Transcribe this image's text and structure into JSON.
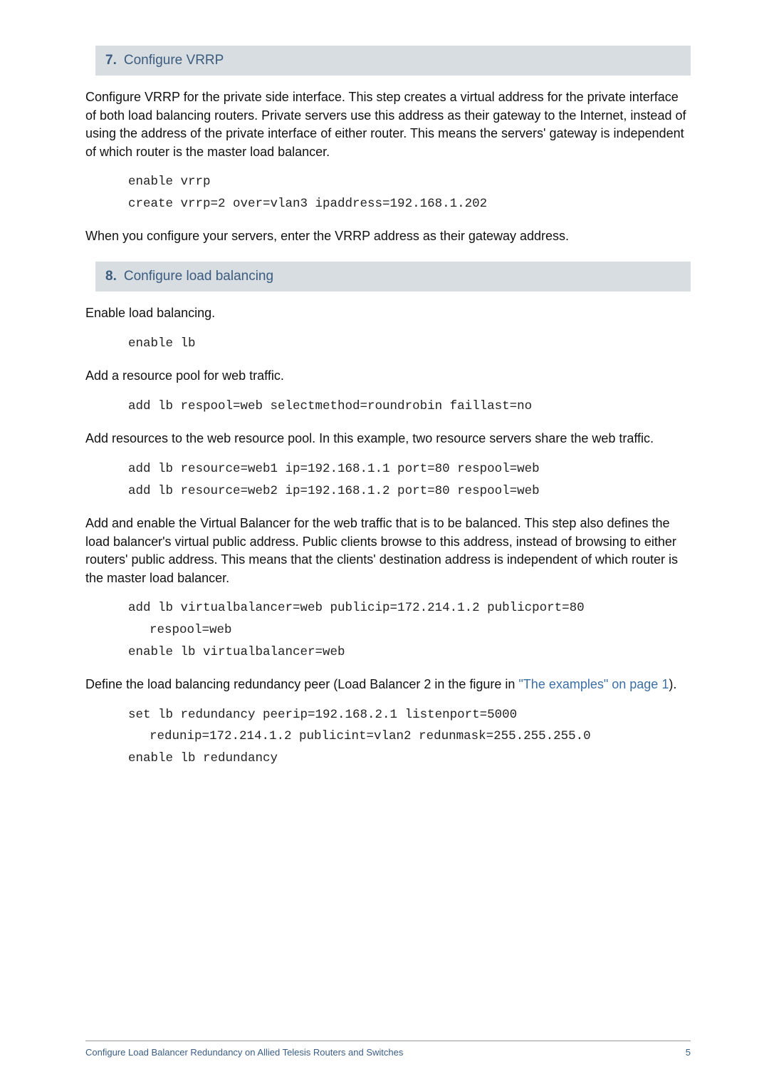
{
  "step7": {
    "number": "7.",
    "title": "Configure VRRP",
    "para1": "Configure VRRP for the private side interface. This step creates a virtual address for the private interface of both load balancing routers. Private servers use this address as their gateway to the Internet, instead of using the address of the private interface of either router. This means the servers' gateway is independent of which router is the master load balancer.",
    "code1_line1": "enable vrrp",
    "code1_line2": "create vrrp=2 over=vlan3 ipaddress=192.168.1.202",
    "para2": "When you configure your servers, enter the VRRP address as their gateway address."
  },
  "step8": {
    "number": "8.",
    "title": "Configure load balancing",
    "para1": "Enable load balancing.",
    "code1": "enable lb",
    "para2": "Add a resource pool for web traffic.",
    "code2": "add lb respool=web selectmethod=roundrobin faillast=no",
    "para3": "Add resources to the web resource pool. In this example, two resource servers share the web traffic.",
    "code3_line1": "add lb resource=web1 ip=192.168.1.1 port=80 respool=web",
    "code3_line2": "add lb resource=web2 ip=192.168.1.2 port=80 respool=web",
    "para4": "Add and enable the Virtual Balancer for the web traffic that is to be balanced. This step also defines the load balancer's virtual public address. Public clients browse to this address, instead of browsing to either routers' public address. This means that the clients' destination address is independent of which router is the master load balancer.",
    "code4_line1": "add lb virtualbalancer=web publicip=172.214.1.2 publicport=80",
    "code4_line1b": "respool=web",
    "code4_line2": "enable lb virtualbalancer=web",
    "para5a": "Define the load balancing redundancy peer (Load Balancer 2 in the figure in ",
    "para5_link": "\"The examples\" on page 1",
    "para5b": ").",
    "code5_line1": "set lb redundancy peerip=192.168.2.1 listenport=5000",
    "code5_line1b": "redunip=172.214.1.2 publicint=vlan2 redunmask=255.255.255.0",
    "code5_line2": "enable lb redundancy"
  },
  "footer": {
    "title": "Configure Load Balancer Redundancy on Allied Telesis Routers and Switches",
    "page": "5"
  }
}
